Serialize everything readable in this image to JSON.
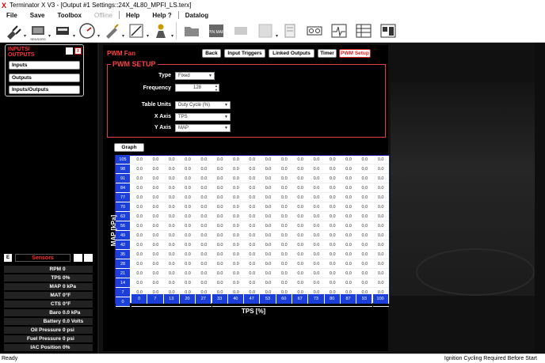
{
  "window": {
    "title": "Terminator X V3 - [Output #1 Settings::24X_4L80_MPFI_LS.terx]",
    "logo": "X"
  },
  "menu": [
    {
      "label": "File",
      "disabled": false
    },
    {
      "label": "Save",
      "disabled": false
    },
    {
      "label": "Toolbox",
      "disabled": false
    },
    {
      "label": "Offline",
      "disabled": true
    },
    {
      "label": "Help",
      "disabled": false
    },
    {
      "label": "Help ?",
      "disabled": false
    },
    {
      "label": "Datalog",
      "disabled": false
    }
  ],
  "toolbar": {
    "sensors_caption": "SENSORS",
    "pinmap_label": "PIN MAP"
  },
  "io_panel": {
    "title_line1": "INPUTS/",
    "title_line2": "OUTPUTS",
    "close": "x",
    "buttons": [
      "Inputs",
      "Outputs",
      "Inputs/Outputs"
    ]
  },
  "sensors": {
    "tag": "E",
    "title": "Sensors",
    "rows": [
      {
        "label": "RPM",
        "value": "0"
      },
      {
        "label": "TPS",
        "value": "0%"
      },
      {
        "label": "MAP",
        "value": "0 kPa"
      },
      {
        "label": "MAT",
        "value": "0°F"
      },
      {
        "label": "CTS",
        "value": "0°F"
      },
      {
        "label": "Baro",
        "value": "0.0 kPa"
      },
      {
        "label": "Battery",
        "value": "0.0 Volts"
      },
      {
        "label": "Oil Pressure",
        "value": "0 psi"
      },
      {
        "label": "Fuel Pressure",
        "value": "0 psi"
      },
      {
        "label": "IAC Position",
        "value": "0%"
      }
    ]
  },
  "pwm": {
    "page_title": "PWM Fan",
    "nav": [
      {
        "label": "Back",
        "active": false
      },
      {
        "label": "Input Triggers",
        "active": false
      },
      {
        "label": "Linked Outputs",
        "active": false
      },
      {
        "label": "Timer",
        "active": false
      },
      {
        "label": "PWM Setup",
        "active": true
      }
    ],
    "setup_title": "PWM SETUP",
    "fields": {
      "type_label": "Type",
      "type_value": "Fixed",
      "freq_label": "Frequency",
      "freq_value": "128",
      "units_label": "Table Units",
      "units_value": "Duty Cycle (%)",
      "xaxis_label": "X Axis",
      "xaxis_value": "TPS",
      "yaxis_label": "Y Axis",
      "yaxis_value": "MAP"
    },
    "graph_label": "Graph",
    "table": {
      "ylabel": "MAP [kPa]",
      "xlabel": "TPS [%]",
      "y": [
        105,
        98,
        91,
        84,
        77,
        70,
        63,
        56,
        49,
        42,
        35,
        28,
        21,
        14,
        7,
        0
      ],
      "x": [
        0,
        7,
        13,
        20,
        27,
        33,
        40,
        47,
        53,
        60,
        67,
        73,
        80,
        87,
        93,
        100
      ],
      "cell_value": "0.0"
    }
  },
  "status": {
    "left": "Ready",
    "right": "Ignition Cycling Required Before Start"
  }
}
